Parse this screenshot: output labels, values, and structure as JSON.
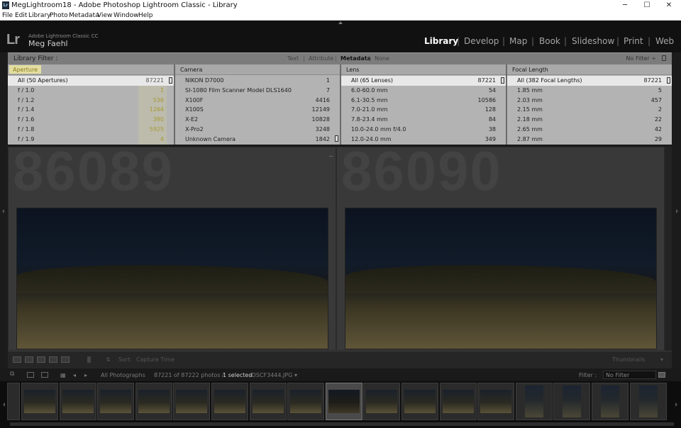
{
  "window": {
    "title": "MegLightroom18 - Adobe Photoshop Lightroom Classic - Library",
    "app_icon": "Lr",
    "minimize": "─",
    "maximize": "☐",
    "close": "✕"
  },
  "menu": [
    "File",
    "Edit",
    "Library",
    "Photo",
    "Metadata",
    "View",
    "Window",
    "Help"
  ],
  "identity": {
    "logo": "Lr",
    "product": "Adobe Lightroom Classic CC",
    "user": "Meg Faehl"
  },
  "modules": [
    {
      "label": "Library",
      "active": true
    },
    {
      "label": "Develop",
      "active": false
    },
    {
      "label": "Map",
      "active": false
    },
    {
      "label": "Book",
      "active": false
    },
    {
      "label": "Slideshow",
      "active": false
    },
    {
      "label": "Print",
      "active": false
    },
    {
      "label": "Web",
      "active": false
    }
  ],
  "filter_bar": {
    "label": "Library Filter :",
    "tabs": [
      "Text",
      "Attribute",
      "Metadata",
      "None"
    ],
    "active_tab": "Metadata",
    "preset": "No Filter ÷"
  },
  "columns": [
    {
      "header": "Aperture",
      "rows": [
        {
          "name": "All (50 Apertures)",
          "count": "87221",
          "selected": true
        },
        {
          "name": "f / 1.0",
          "count": "1"
        },
        {
          "name": "f / 1.2",
          "count": "536"
        },
        {
          "name": "f / 1.4",
          "count": "1264"
        },
        {
          "name": "f / 1.6",
          "count": "390"
        },
        {
          "name": "f / 1.8",
          "count": "5925"
        },
        {
          "name": "f / 1.9",
          "count": "4"
        }
      ]
    },
    {
      "header": "Camera",
      "rows": [
        {
          "name": "NIKON D7000",
          "count": "1"
        },
        {
          "name": "SI-1080 Film Scanner Model DLS1640",
          "count": "7"
        },
        {
          "name": "X100F",
          "count": "4416"
        },
        {
          "name": "X100S",
          "count": "12149"
        },
        {
          "name": "X-E2",
          "count": "10828"
        },
        {
          "name": "X-Pro2",
          "count": "3248"
        },
        {
          "name": "Unknown Camera",
          "count": "1842"
        }
      ]
    },
    {
      "header": "Lens",
      "rows": [
        {
          "name": "All (65 Lenses)",
          "count": "87221",
          "selected": true
        },
        {
          "name": "6.0-60.0 mm",
          "count": "54"
        },
        {
          "name": "6.1-30.5 mm",
          "count": "10586"
        },
        {
          "name": "7.0-21.0 mm",
          "count": "128"
        },
        {
          "name": "7.8-23.4 mm",
          "count": "84"
        },
        {
          "name": "10.0-24.0 mm f/4.0",
          "count": "38"
        },
        {
          "name": "12.0-24.0 mm",
          "count": "349"
        }
      ]
    },
    {
      "header": "Focal Length",
      "rows": [
        {
          "name": "All (382 Focal Lengths)",
          "count": "87221",
          "selected": true
        },
        {
          "name": "1.85 mm",
          "count": "5"
        },
        {
          "name": "2.03 mm",
          "count": "457"
        },
        {
          "name": "2.15 mm",
          "count": "2"
        },
        {
          "name": "2.18 mm",
          "count": "22"
        },
        {
          "name": "2.65 mm",
          "count": "42"
        },
        {
          "name": "2.87 mm",
          "count": "29"
        }
      ]
    }
  ],
  "grid": {
    "cells": [
      {
        "index": "86089"
      },
      {
        "index": "86090"
      }
    ]
  },
  "toolbar": {
    "sort_label": "Sort:",
    "sort_value": "Capture Time",
    "thumbnails_label": "Thumbnails"
  },
  "filmstrip_bar": {
    "source": "All Photographs",
    "count": "87221 of 87222 photos /",
    "selected": "1 selected",
    "file": "/DSCF3444.JPG ▾",
    "filter_label": "Filter :",
    "filter_value": "No Filter"
  },
  "filmstrip": {
    "thumb_count": 17,
    "active_index": 8
  }
}
